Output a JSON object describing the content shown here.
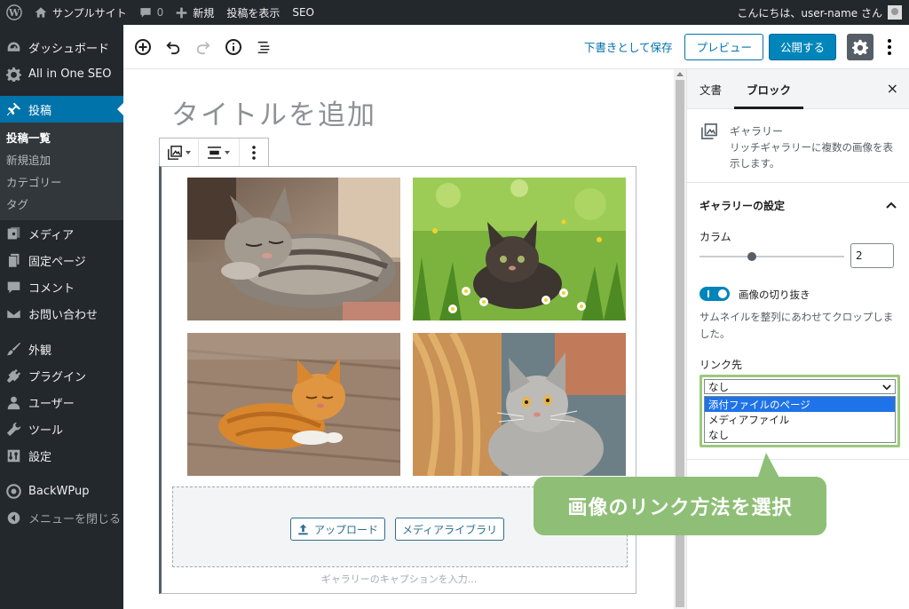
{
  "admin_bar": {
    "site_name": "サンプルサイト",
    "comments_count": "0",
    "new_label": "新規",
    "view_post": "投稿を表示",
    "seo": "SEO",
    "greeting": "こんにちは、user-name さん"
  },
  "sidebar": {
    "dashboard": "ダッシュボード",
    "aioseo": "All in One SEO",
    "posts": "投稿",
    "posts_sub": [
      "投稿一覧",
      "新規追加",
      "カテゴリー",
      "タグ"
    ],
    "media": "メディア",
    "pages": "固定ページ",
    "comments": "コメント",
    "contact": "お問い合わせ",
    "appearance": "外観",
    "plugins": "プラグイン",
    "users": "ユーザー",
    "tools": "ツール",
    "settings": "設定",
    "backwpup": "BackWPup",
    "collapse": "メニューを閉じる"
  },
  "toolbar": {
    "save_draft": "下書きとして保存",
    "preview": "プレビュー",
    "publish": "公開する"
  },
  "editor": {
    "title_placeholder": "タイトルを追加",
    "upload": "アップロード",
    "media_library": "メディアライブラリ",
    "caption_placeholder": "ギャラリーのキャプションを入力..."
  },
  "settings_sidebar": {
    "tab_document": "文書",
    "tab_block": "ブロック",
    "close": "×",
    "block_name": "ギャラリー",
    "block_desc": "リッチギャラリーに複数の画像を表示します。",
    "panel_title": "ギャラリーの設定",
    "columns_label": "カラム",
    "columns_value": "2",
    "columns_range_value": 2,
    "crop_label": "画像の切り抜き",
    "crop_enabled": true,
    "crop_help": "サムネイルを整列にあわせてクロップしました。",
    "link_label": "リンク先",
    "link_selected": "なし",
    "link_options": [
      "添付ファイルのページ",
      "メディアファイル",
      "なし"
    ]
  },
  "callout": {
    "text": "画像のリンク方法を選択"
  },
  "colors": {
    "admin_dark": "#23282d",
    "active_blue": "#0073aa",
    "callout_green": "#8fbf76"
  }
}
